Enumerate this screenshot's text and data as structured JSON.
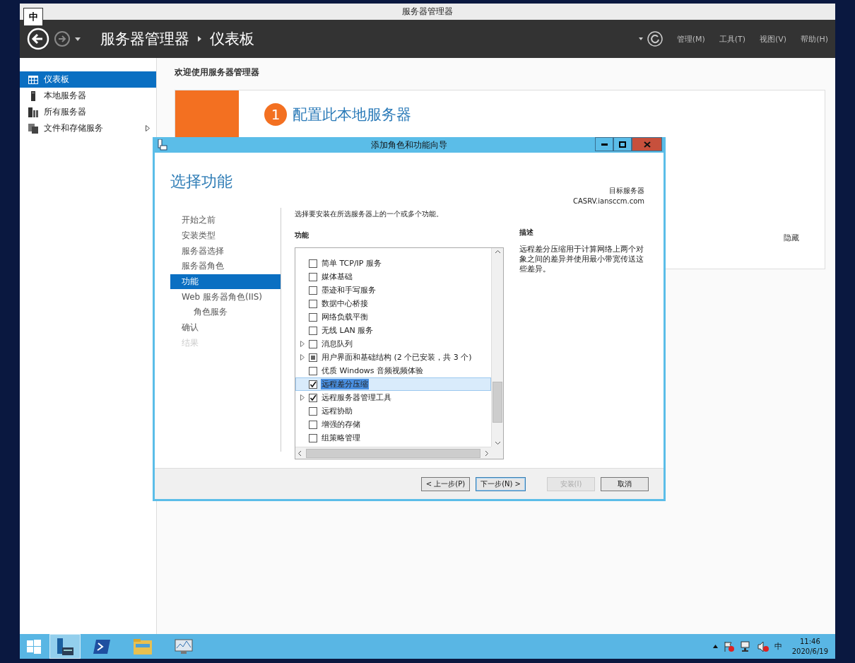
{
  "ime_indicator": "中",
  "window": {
    "title": "服务器管理器"
  },
  "header": {
    "breadcrumb": [
      "服务器管理器",
      "仪表板"
    ],
    "menu": [
      "管理(M)",
      "工具(T)",
      "视图(V)",
      "帮助(H)"
    ]
  },
  "sidebar": {
    "items": [
      {
        "label": "仪表板",
        "selected": true,
        "kind": "dashboard",
        "expandable": false
      },
      {
        "label": "本地服务器",
        "selected": false,
        "kind": "server",
        "expandable": false
      },
      {
        "label": "所有服务器",
        "selected": false,
        "kind": "servers",
        "expandable": false
      },
      {
        "label": "文件和存储服务",
        "selected": false,
        "kind": "storage",
        "expandable": true
      }
    ]
  },
  "dashboard": {
    "welcome": "欢迎使用服务器管理器",
    "step_number": "1",
    "step_title": "配置此本地服务器",
    "hide": "隐藏"
  },
  "dialog": {
    "title": "添加角色和功能向导",
    "heading": "选择功能",
    "target_label": "目标服务器",
    "target_server": "CASRV.iansccm.com",
    "nav": [
      {
        "label": "开始之前",
        "selected": false,
        "disabled": false
      },
      {
        "label": "安装类型",
        "selected": false,
        "disabled": false
      },
      {
        "label": "服务器选择",
        "selected": false,
        "disabled": false
      },
      {
        "label": "服务器角色",
        "selected": false,
        "disabled": false
      },
      {
        "label": "功能",
        "selected": true,
        "disabled": false
      },
      {
        "label": "Web 服务器角色(IIS)",
        "selected": false,
        "disabled": false,
        "children": [
          {
            "label": "角色服务",
            "selected": false,
            "disabled": false
          }
        ]
      },
      {
        "label": "确认",
        "selected": false,
        "disabled": false
      },
      {
        "label": "结果",
        "selected": false,
        "disabled": true
      }
    ],
    "instruction": "选择要安装在所选服务器上的一个或多个功能。",
    "features_heading": "功能",
    "features": [
      {
        "label": "简单 TCP/IP 服务",
        "checked": false,
        "indeterminate": false,
        "expandable": false,
        "selected": false
      },
      {
        "label": "媒体基础",
        "checked": false,
        "indeterminate": false,
        "expandable": false,
        "selected": false
      },
      {
        "label": "墨迹和手写服务",
        "checked": false,
        "indeterminate": false,
        "expandable": false,
        "selected": false
      },
      {
        "label": "数据中心桥接",
        "checked": false,
        "indeterminate": false,
        "expandable": false,
        "selected": false
      },
      {
        "label": "网络负载平衡",
        "checked": false,
        "indeterminate": false,
        "expandable": false,
        "selected": false
      },
      {
        "label": "无线 LAN 服务",
        "checked": false,
        "indeterminate": false,
        "expandable": false,
        "selected": false
      },
      {
        "label": "消息队列",
        "checked": false,
        "indeterminate": false,
        "expandable": true,
        "selected": false
      },
      {
        "label": "用户界面和基础结构 (2 个已安装，共 3 个)",
        "checked": false,
        "indeterminate": true,
        "expandable": true,
        "selected": false
      },
      {
        "label": "优质 Windows 音频视频体验",
        "checked": false,
        "indeterminate": false,
        "expandable": false,
        "selected": false
      },
      {
        "label": "远程差分压缩",
        "checked": true,
        "indeterminate": false,
        "expandable": false,
        "selected": true
      },
      {
        "label": "远程服务器管理工具",
        "checked": true,
        "indeterminate": false,
        "expandable": true,
        "selected": false
      },
      {
        "label": "远程协助",
        "checked": false,
        "indeterminate": false,
        "expandable": false,
        "selected": false
      },
      {
        "label": "增强的存储",
        "checked": false,
        "indeterminate": false,
        "expandable": false,
        "selected": false
      },
      {
        "label": "组策略管理",
        "checked": false,
        "indeterminate": false,
        "expandable": false,
        "selected": false
      }
    ],
    "description_heading": "描述",
    "description": "远程差分压缩用于计算网络上两个对象之间的差异并使用最小带宽传送这些差异。",
    "buttons": [
      {
        "label": "< 上一步(P)",
        "disabled": false,
        "focused": false
      },
      {
        "label": "下一步(N) >",
        "disabled": false,
        "focused": true
      },
      {
        "label": "安装(I)",
        "disabled": true,
        "focused": false
      },
      {
        "label": "取消",
        "disabled": false,
        "focused": false
      }
    ]
  },
  "taskbar": {
    "apps": [
      {
        "kind": "server-manager",
        "selected": true
      },
      {
        "kind": "powershell",
        "selected": false
      },
      {
        "kind": "explorer",
        "selected": false
      },
      {
        "kind": "monitor",
        "selected": false
      }
    ],
    "language": "中",
    "time": "11:46",
    "date": "2020/6/19"
  }
}
